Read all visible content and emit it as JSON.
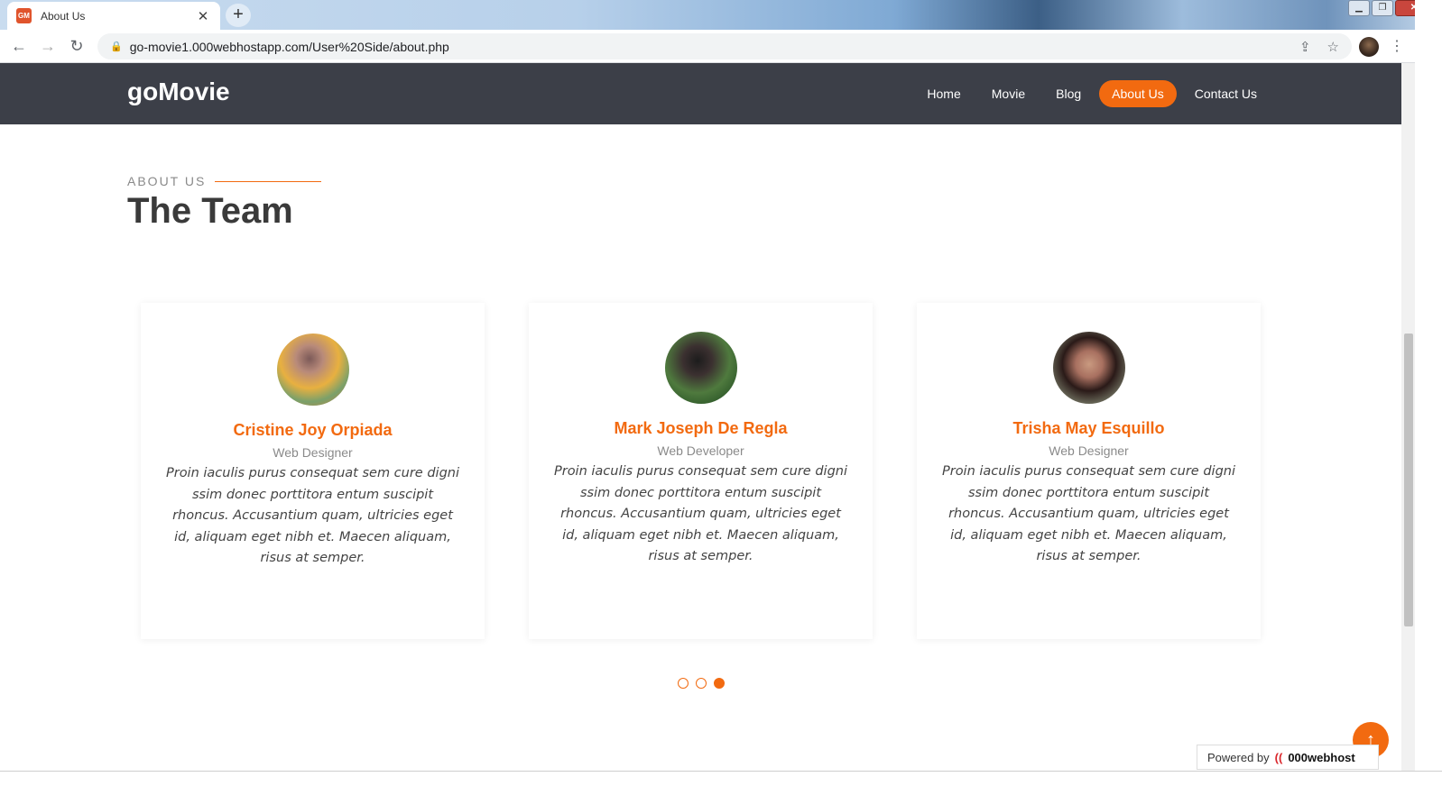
{
  "browser": {
    "tab_title": "About Us",
    "favicon_text": "GM",
    "url": "go-movie1.000webhostapp.com/User%20Side/about.php"
  },
  "site": {
    "brand": "goMovie",
    "nav": [
      {
        "label": "Home"
      },
      {
        "label": "Movie"
      },
      {
        "label": "Blog"
      },
      {
        "label": "About Us",
        "active": true
      },
      {
        "label": "Contact Us"
      }
    ]
  },
  "section": {
    "eyebrow": "ABOUT US",
    "title": "The Team"
  },
  "team": [
    {
      "name": "Cristine Joy Orpiada",
      "role": "Web Designer",
      "bio": "Proin iaculis purus consequat sem cure digni ssim donec porttitora entum suscipit rhoncus. Accusantium quam, ultricies eget id, aliquam eget nibh et. Maecen aliquam, risus at semper."
    },
    {
      "name": "Mark Joseph De Regla",
      "role": "Web Developer",
      "bio": "Proin iaculis purus consequat sem cure digni ssim donec porttitora entum suscipit rhoncus. Accusantium quam, ultricies eget id, aliquam eget nibh et. Maecen aliquam, risus at semper."
    },
    {
      "name": "Trisha May Esquillo",
      "role": "Web Designer",
      "bio": "Proin iaculis purus consequat sem cure digni ssim donec porttitora entum suscipit rhoncus. Accusantium quam, ultricies eget id, aliquam eget nibh et. Maecen aliquam, risus at semper."
    }
  ],
  "carousel": {
    "pages": 3,
    "active_page": 3
  },
  "footer": {
    "powered_by": "Powered by",
    "host_brand": "000webhost"
  },
  "colors": {
    "accent": "#f26a10",
    "nav_bg": "#3c3f48",
    "heading": "#3a3a3a"
  }
}
